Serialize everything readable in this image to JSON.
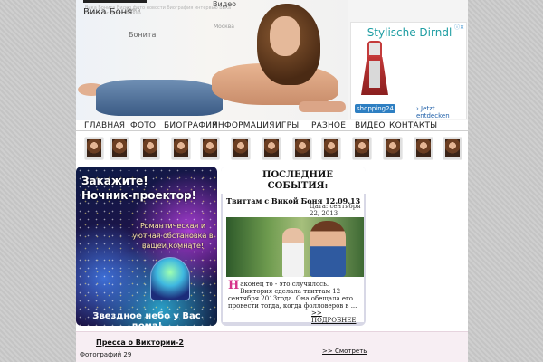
{
  "header": {
    "site_title": "Вика Боня",
    "top_video": "Видео",
    "tag_bonita": "Бонита",
    "tag_cloud": "Вика Бонита Видео фото новости биография интервью Вика Боня блог фото Москва",
    "tag_moscow": "Москва",
    "tag_vika": "Вика"
  },
  "ad": {
    "title": "Stylische Dirndl",
    "badge": "shopping24",
    "link": "Jetzt entdecken",
    "close": "ⓘ✕"
  },
  "nav": {
    "items": [
      "ГЛАВНАЯ",
      "ФОТО",
      "БИОГРАФИЯ",
      "ИНФОРМАЦИЯ",
      "ИГРЫ",
      "РАЗНОЕ",
      "ВИДЕО",
      "КОНТАКТЫ"
    ]
  },
  "banner": {
    "title_line1": "Закажите!",
    "title_line2": "Ночник-проектор!",
    "subtitle": "Романтическая и уютная обстановка в вашей комнате!",
    "bottom": "Звездное небо у Вас дома!"
  },
  "events": {
    "heading_line1": "ПОСЛЕДНИЕ",
    "heading_line2": "СОБЫТИЯ:",
    "news_title": "Твиттам с Викой Боня 12.09.13",
    "news_date": "Дата: сентября 22, 2013",
    "news_drop": "Н",
    "news_text": "аконец то - это случилось. Виктория сделала твиттам 12 сентября 2013года. Она обещала его провести тогда, когда фолловеров в ...",
    "more": ">> ПОДРОБНЕЕ"
  },
  "press": {
    "link": "Пресса о Виктории-2",
    "watch": ">> Смотреть",
    "count": "Фотографий 29"
  },
  "colors": {
    "ad_title": "#1f9ea3",
    "drop_cap": "#d6338a",
    "events_bg": "#d8d8e6",
    "press_bg": "#f7eef3"
  }
}
